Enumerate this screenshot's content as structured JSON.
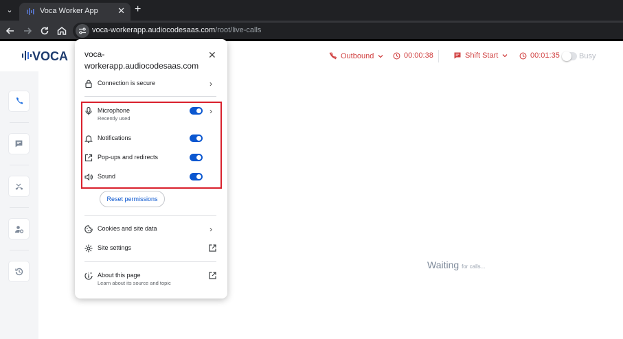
{
  "browser": {
    "tab_title": "Voca Worker App",
    "tab_close": "✕",
    "new_tab": "+",
    "url_host": "voca-workerapp.audiocodesaas.com",
    "url_path": "/root/live-calls"
  },
  "app": {
    "logo_text": "VOCA",
    "header": {
      "outbound_label": "Outbound",
      "call_timer": "00:00:38",
      "shift_label": "Shift Start",
      "shift_timer": "00:01:35",
      "busy_label": "Busy"
    },
    "accent_color": "#d04040",
    "waiting_text": "Waiting",
    "waiting_sub": "for calls..."
  },
  "popup": {
    "site_title": "voca-workerapp.audiocodesaas.com",
    "connection_label": "Connection is secure",
    "permissions": [
      {
        "label": "Microphone",
        "sub": "Recently used",
        "enabled": true,
        "icon": "microphone-icon"
      },
      {
        "label": "Notifications",
        "enabled": true,
        "icon": "bell-icon"
      },
      {
        "label": "Pop-ups and redirects",
        "enabled": true,
        "icon": "popup-icon"
      },
      {
        "label": "Sound",
        "enabled": true,
        "icon": "speaker-icon"
      }
    ],
    "reset_label": "Reset permissions",
    "cookies_label": "Cookies and site data",
    "site_settings_label": "Site settings",
    "about_label": "About this page",
    "about_sub": "Learn about its source and topic",
    "switch_color": "#0b57d0",
    "highlight_color": "#d9202c"
  }
}
